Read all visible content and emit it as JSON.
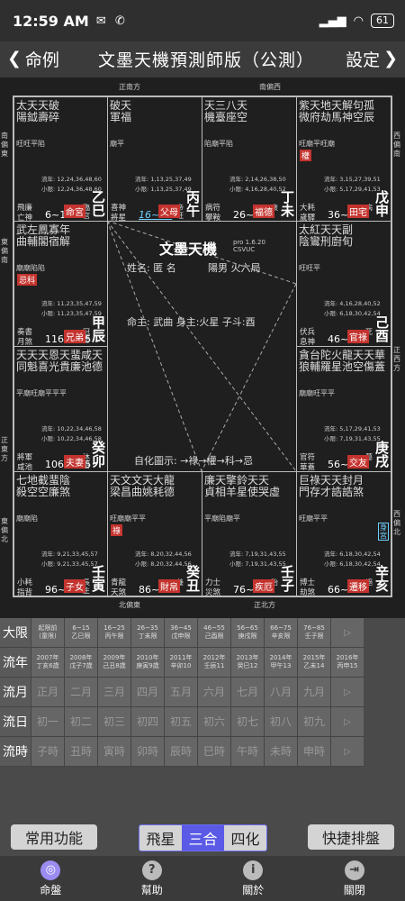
{
  "status": {
    "time": "12:59 AM",
    "battery": "61"
  },
  "title": {
    "back": "命例",
    "main": "文墨天機預測師版（公測）",
    "settings": "設定"
  },
  "compass": {
    "top_left": "正南方",
    "top_right": "南偏西",
    "bottom_left": "北偏東",
    "bottom_right": "正北方",
    "left_1": "南偏東",
    "left_2": "東偏南",
    "left_3": "正東方",
    "left_4": "東偏北",
    "right_1": "西偏南",
    "right_2": "正西方",
    "right_3": "西偏北"
  },
  "palaces": {
    "si": {
      "stars1": "太天天破",
      "stars2": "陽鉞壽碎",
      "bright": "旺旺平陷",
      "years": "流年: 12,24,36,48,60",
      "small": "小限: 12,24,36,48,60",
      "gods": "飛廉 亡神 病符",
      "range": "6~15",
      "life": "臨官",
      "name": "命宮",
      "branch": "乙巳"
    },
    "wu": {
      "stars1": "破天",
      "stars2": "軍福",
      "bright": "廟平",
      "years": "流年: 1,13,25,37,49",
      "small": "小限: 1,13,25,37,49",
      "gods": "喜神 將星 歲建",
      "range": "16~25",
      "life": "帝旺",
      "name": "父母",
      "branch": "丙午"
    },
    "wei": {
      "stars1": "天三八天",
      "stars2": "機臺座空",
      "bright": "陷廟平陷",
      "years": "流年: 2,14,26,38,50",
      "small": "小限: 4,16,28,40,52",
      "gods": "病符 攀鞍 晦氣",
      "range": "26~35",
      "life": "衰",
      "name": "福德",
      "branch": "丁未"
    },
    "shen": {
      "stars1": "紫天地天解句孤",
      "stars2": "微府劫馬神空辰",
      "bright": "旺廟平旺廟",
      "years": "流年: 3,15,27,39,51",
      "small": "小限: 5,17,29,41,53",
      "hua": "權",
      "gods": "大耗 歲驛 喪門",
      "range": "36~45",
      "life": "病",
      "name": "田宅",
      "branch": "戊申"
    },
    "chen": {
      "stars1": "武左鳳寡年",
      "stars2": "曲輔閣宿解",
      "bright": "廟廟陷陷",
      "years": "流年: 11,23,35,47,59",
      "small": "小限: 11,23,35,47,59",
      "hua": "忌科",
      "gods": "奏書 月煞 弔客",
      "range": "116~125",
      "life": "冠帶",
      "name": "兄弟",
      "branch": "甲辰"
    },
    "you": {
      "stars1": "太紅天天副",
      "stars2": "陰鸞刑廚旬",
      "bright": "旺旺平",
      "years": "流年: 4,16,28,40,52",
      "small": "小限: 6,18,30,42,54",
      "gods": "伏兵 息神 貫索",
      "range": "46~55",
      "life": "死",
      "name": "官祿",
      "branch": "己酉"
    },
    "mao": {
      "stars1": "天天天恩天蜚咸天",
      "stars2": "同魁喜光貴廉池德",
      "bright": "平廟旺廟平平平",
      "years": "流年: 10,22,34,46,58",
      "small": "小限: 10,22,34,46,58",
      "gods": "將軍 咸池 天德",
      "range": "106~115",
      "life": "沐浴",
      "name": "夫妻",
      "branch": "癸卯"
    },
    "xu": {
      "stars1": "貪台陀火龍天天華",
      "stars2": "狼輔羅星池空傷蓋",
      "bright": "廟廟旺平平",
      "years": "流年: 5,17,29,41,53",
      "small": "小限: 7,19,31,43,55",
      "gods": "官符 華蓋 官符",
      "range": "56~65",
      "life": "墓",
      "name": "交友",
      "branch": "庚戌"
    },
    "yin": {
      "stars1": "七地截蜚陰",
      "stars2": "殺空空廉煞",
      "bright": "廟廟陷",
      "years": "流年: 9,21,33,45,57",
      "small": "小限: 9,21,33,45,57",
      "gods": "小耗 指背 白虎",
      "range": "96~105",
      "life": "長生",
      "name": "子女",
      "branch": "壬寅"
    },
    "chou": {
      "stars1": "天文文天大龍",
      "stars2": "梁昌曲姚耗德",
      "bright": "旺廟廟平平",
      "years": "流年: 8,20,32,44,56",
      "small": "小限: 8,20,32,44,56",
      "hua": "祿",
      "gods": "青龍 天煞 龍德",
      "range": "86~95",
      "life": "養",
      "name": "財帛",
      "branch": "癸丑"
    },
    "zi": {
      "stars1": "廉天擎鈴天天",
      "stars2": "貞相羊星使哭虛",
      "bright": "平廟陷廟平",
      "years": "流年: 7,19,31,43,55",
      "small": "小限: 7,19,31,43,55",
      "gods": "力士 災煞 歲破",
      "range": "76~85",
      "life": "胎",
      "name": "疾厄",
      "branch": "壬子"
    },
    "hai": {
      "stars1": "巨祿天天封月",
      "stars2": "門存才誥誥煞",
      "bright": "旺廟平平",
      "years": "流年: 6,18,30,42,54",
      "small": "小限: 6,18,30,42,54",
      "gods": "博士 劫煞 小耗",
      "range": "66~75",
      "life": "絕",
      "name": "遷移",
      "branch": "辛亥",
      "badge": "身宮"
    }
  },
  "center": {
    "app": "文墨天機",
    "ver1": "pro 1.6.20",
    "ver2": "CSVUC",
    "name": "姓名: 匿 名",
    "yinyang": "陽男 火六局",
    "master": "命主: 武曲 身主:火星 子斗:酉",
    "sihua": "自化圖示: →祿→權→科→忌"
  },
  "table": {
    "daxian": {
      "label": "大限",
      "cells": [
        [
          "起限前",
          "(童限)"
        ],
        [
          "6~15",
          "乙巳限"
        ],
        [
          "16~25",
          "丙午限"
        ],
        [
          "26~35",
          "丁未限"
        ],
        [
          "36~45",
          "戊申限"
        ],
        [
          "46~55",
          "己酉限"
        ],
        [
          "56~65",
          "庚戌限"
        ],
        [
          "66~75",
          "辛亥限"
        ],
        [
          "76~85",
          "壬子限"
        ]
      ]
    },
    "liunian": {
      "label": "流年",
      "cells": [
        [
          "2007年",
          "丁亥6歲"
        ],
        [
          "2008年",
          "戊子7歲"
        ],
        [
          "2009年",
          "己丑8歲"
        ],
        [
          "2010年",
          "庚寅9歲"
        ],
        [
          "2011年",
          "辛卯10"
        ],
        [
          "2012年",
          "壬辰11"
        ],
        [
          "2013年",
          "癸巳12"
        ],
        [
          "2014年",
          "甲午13"
        ],
        [
          "2015年",
          "乙未14"
        ],
        [
          "2016年",
          "丙申15"
        ]
      ]
    },
    "liuyue": {
      "label": "流月",
      "cells": [
        "正月",
        "二月",
        "三月",
        "四月",
        "五月",
        "六月",
        "七月",
        "八月",
        "九月"
      ]
    },
    "liuri": {
      "label": "流日",
      "cells": [
        "初一",
        "初二",
        "初三",
        "初四",
        "初五",
        "初六",
        "初七",
        "初八",
        "初九"
      ]
    },
    "liushi": {
      "label": "流時",
      "cells": [
        "子時",
        "丑時",
        "寅時",
        "卯時",
        "辰時",
        "巳時",
        "午時",
        "未時",
        "申時"
      ]
    }
  },
  "toolbar": {
    "common": "常用功能",
    "seg": [
      "飛星",
      "三合",
      "四化"
    ],
    "quick": "快捷排盤"
  },
  "nav": [
    {
      "label": "命盤",
      "icon": "◎"
    },
    {
      "label": "幫助",
      "icon": "?"
    },
    {
      "label": "關於",
      "icon": "i"
    },
    {
      "label": "關閉",
      "icon": "⇥"
    }
  ]
}
